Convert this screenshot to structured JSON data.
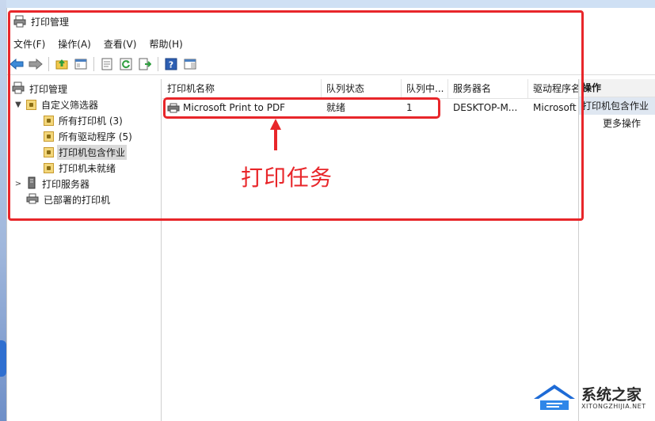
{
  "window": {
    "title": "打印管理"
  },
  "menu": [
    "文件(F)",
    "操作(A)",
    "查看(V)",
    "帮助(H)"
  ],
  "toolbar": {
    "icons": [
      "back-arrow-icon",
      "forward-arrow-icon",
      "up-folder-icon",
      "show-hide-tree-icon",
      "properties-icon",
      "refresh-icon",
      "export-list-icon",
      "help-icon",
      "action-pane-icon"
    ]
  },
  "tree": {
    "root": "打印管理",
    "custom_filters": "自定义筛选器",
    "all_printers": "所有打印机 (3)",
    "all_drivers": "所有驱动程序 (5)",
    "printers_with_jobs": "打印机包含作业",
    "printers_not_ready": "打印机未就绪",
    "print_servers": "打印服务器",
    "deployed_printers": "已部署的打印机"
  },
  "list": {
    "columns": [
      "打印机名称",
      "队列状态",
      "队列中...",
      "服务器名",
      "驱动程序名"
    ],
    "rows": [
      {
        "name": "Microsoft Print to PDF",
        "status": "就绪",
        "jobs": "1",
        "server": "DESKTOP-M...",
        "driver": "Microsoft"
      }
    ]
  },
  "actions": {
    "header": "操作",
    "selected": "打印机包含作业",
    "more": "更多操作"
  },
  "annotation": {
    "label": "打印任务",
    "color": "#e8262a"
  },
  "watermark": {
    "name": "系统之家",
    "url": "XITONGZHIJIA.NET"
  },
  "colors": {
    "highlight": "#e8262a",
    "selection": "#d9d9d9",
    "accent": "#2f6fd0"
  }
}
